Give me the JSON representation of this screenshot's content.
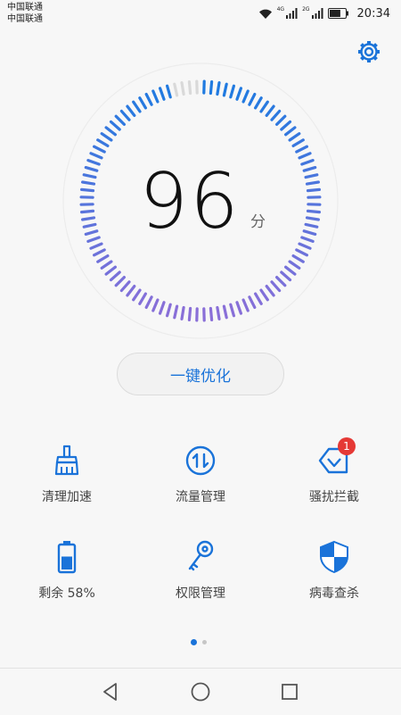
{
  "status_bar": {
    "carrier_1": "中国联通",
    "carrier_2": "中国联通",
    "sim1_network": "4G",
    "sim2_network": "2G",
    "time": "20:34",
    "battery_level": 0.7
  },
  "gauge": {
    "score": "96",
    "unit": "分",
    "score_fraction": 0.96
  },
  "optimize_button": {
    "label": "一键优化"
  },
  "tiles": [
    {
      "label": "清理加速",
      "icon": "broom-icon"
    },
    {
      "label": "流量管理",
      "icon": "data-traffic-icon"
    },
    {
      "label": "骚扰拦截",
      "icon": "harassment-block-icon",
      "badge": "1"
    },
    {
      "label": "剩余 58%",
      "icon": "battery-icon",
      "battery_level": 0.58
    },
    {
      "label": "权限管理",
      "icon": "key-icon"
    },
    {
      "label": "病毒查杀",
      "icon": "shield-icon"
    }
  ],
  "pager": {
    "pages": 2,
    "current": 1
  },
  "colors": {
    "accent": "#1a73d9",
    "gauge_top": "#1f7ae0",
    "gauge_bottom": "#8a6fd8",
    "gauge_inactive": "#d9d9d9",
    "badge": "#e53935"
  }
}
